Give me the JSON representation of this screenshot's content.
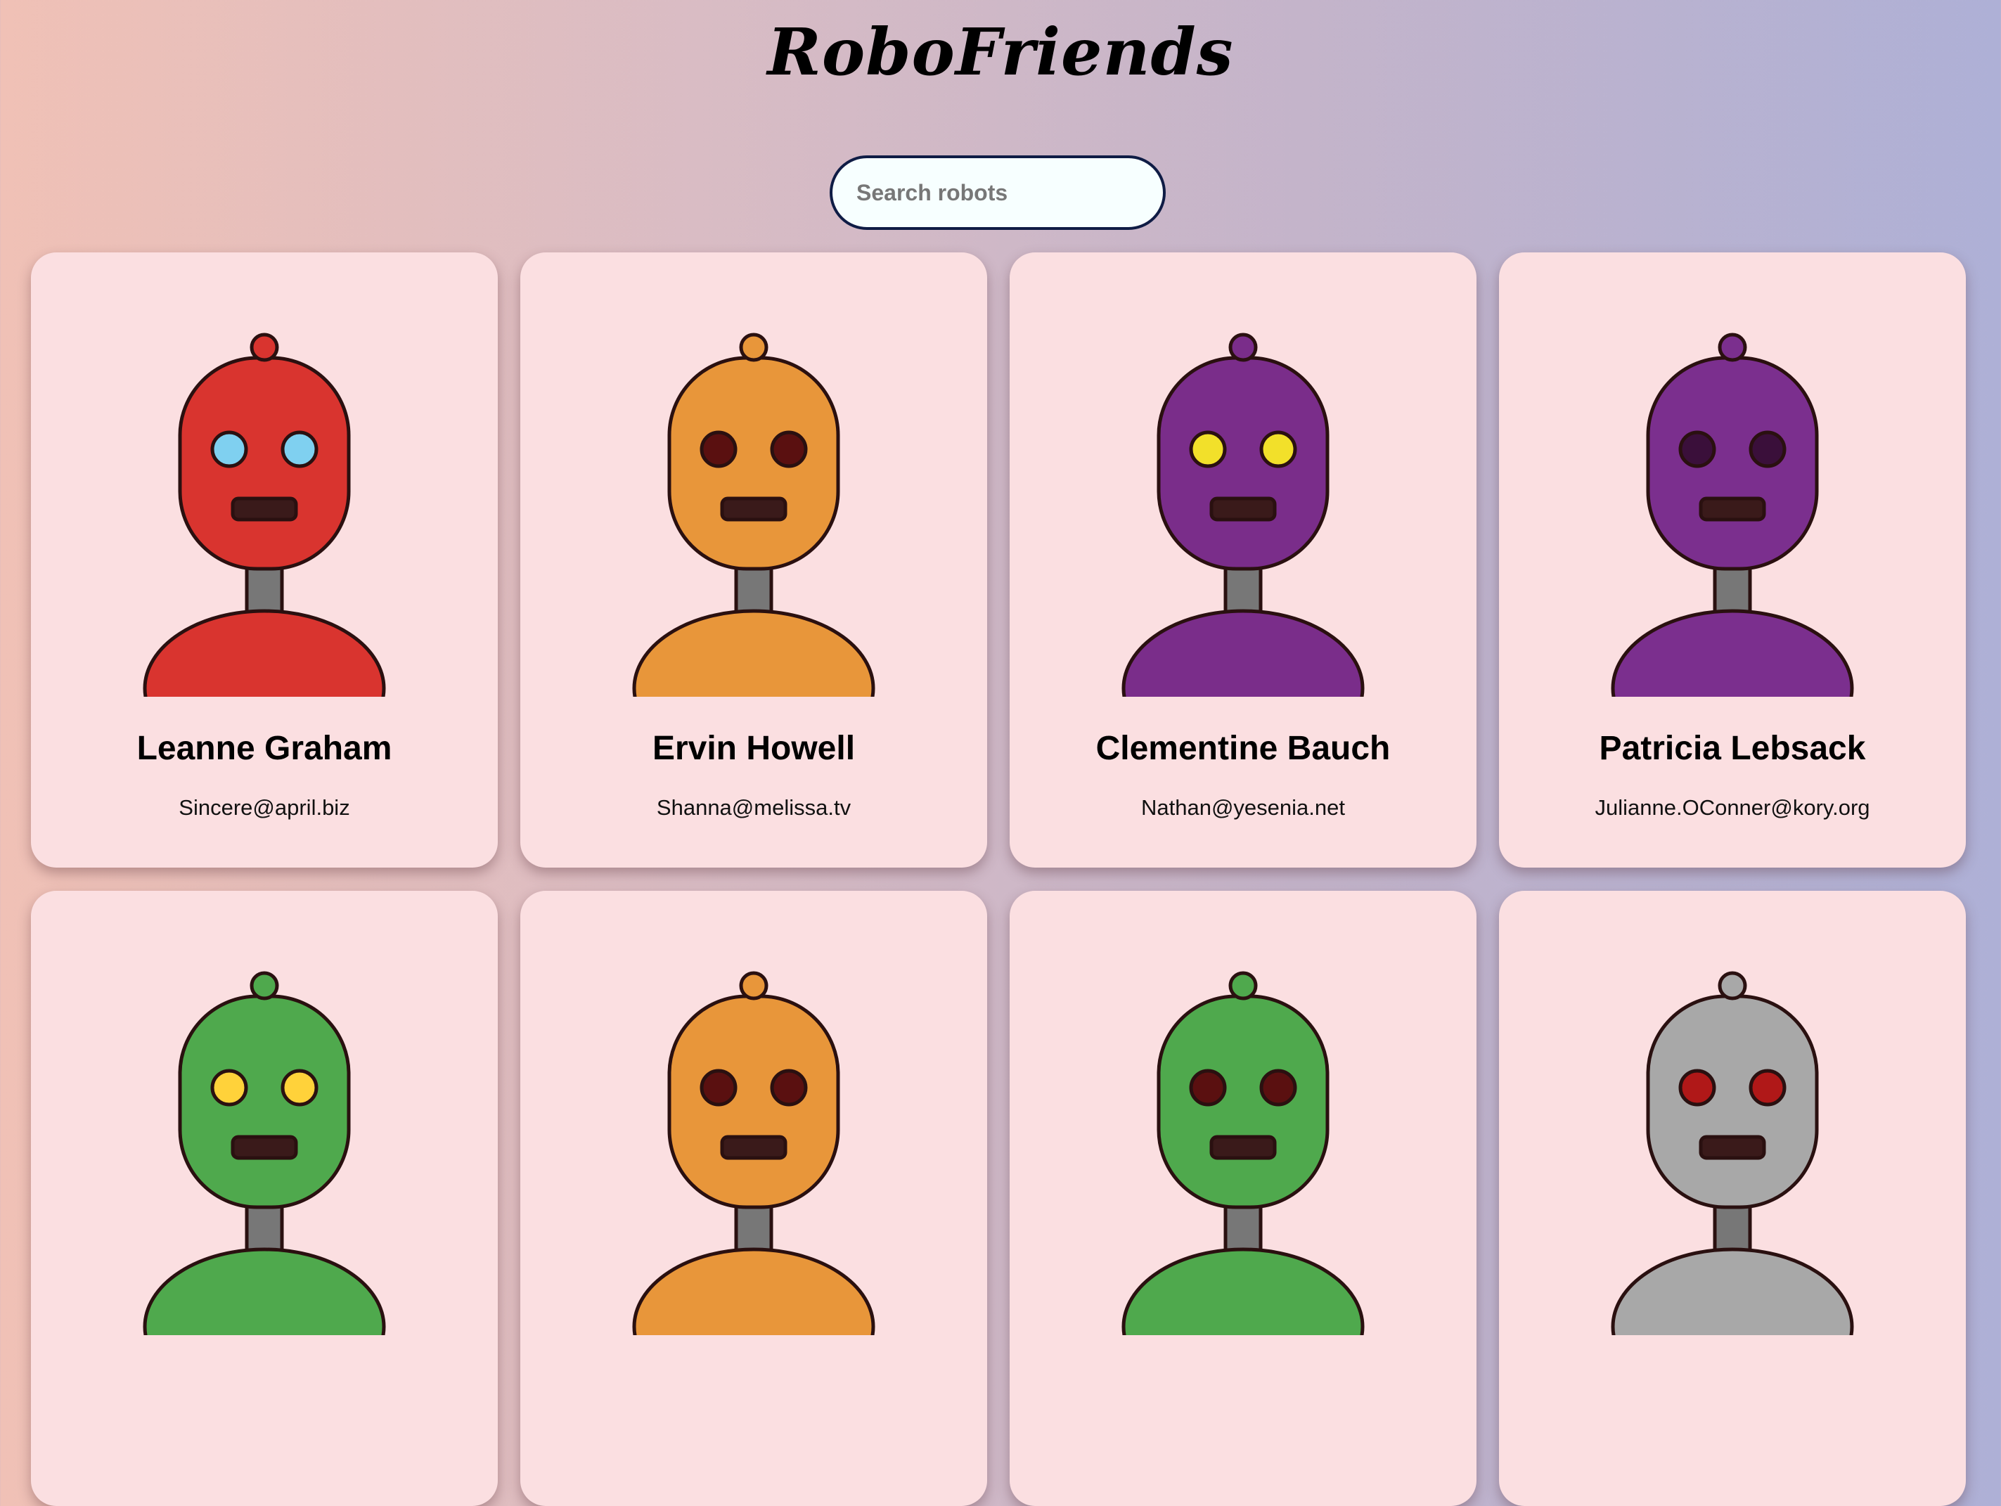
{
  "header": {
    "title": "RoboFriends"
  },
  "search": {
    "placeholder": "Search robots",
    "value": ""
  },
  "robots": [
    {
      "name": "Leanne Graham",
      "email": "Sincere@april.biz",
      "color": "#d9342f",
      "eye": "#7fd0f0"
    },
    {
      "name": "Ervin Howell",
      "email": "Shanna@melissa.tv",
      "color": "#e8963a",
      "eye": "#5a1010"
    },
    {
      "name": "Clementine Bauch",
      "email": "Nathan@yesenia.net",
      "color": "#7a2d8a",
      "eye": "#f2e02a"
    },
    {
      "name": "Patricia Lebsack",
      "email": "Julianne.OConner@kory.org",
      "color": "#7b2f8e",
      "eye": "#3a0f3a"
    },
    {
      "color": "#4fa94d",
      "eye": "#ffd23a"
    },
    {
      "color": "#e8963a",
      "eye": "#5a1010"
    },
    {
      "color": "#4fa94d",
      "eye": "#5a1010"
    },
    {
      "color": "#a8a8a8",
      "eye": "#b01818"
    }
  ],
  "colors": {
    "card": "#fbdfe1",
    "search_border": "#0f1c45"
  }
}
